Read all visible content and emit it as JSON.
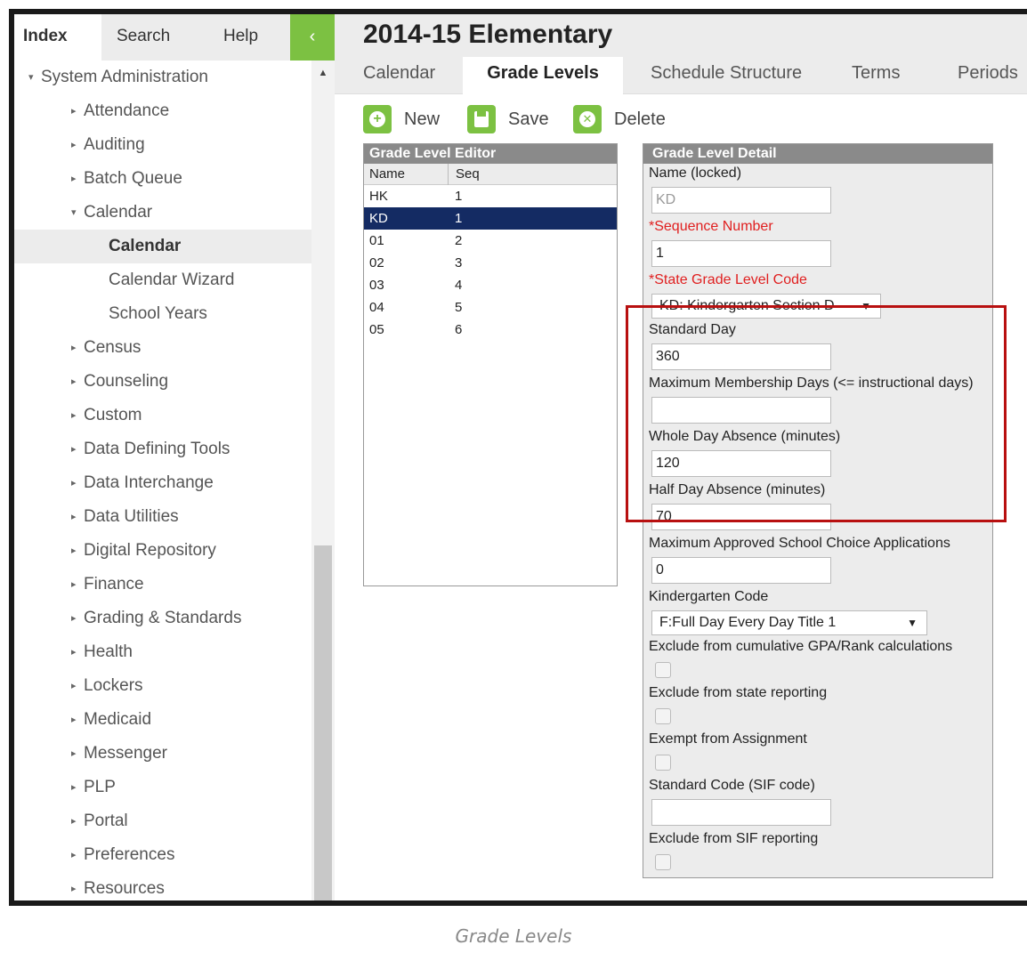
{
  "sidebar": {
    "tabs": {
      "index": "Index",
      "search": "Search",
      "help": "Help"
    },
    "collapse_glyph": "‹",
    "scroll_up_glyph": "▲",
    "collapsed_marker": "▸",
    "expanded_marker": "▾",
    "root": "System Administration",
    "items": [
      "Attendance",
      "Auditing",
      "Batch Queue",
      "Calendar",
      "Census",
      "Counseling",
      "Custom",
      "Data Defining Tools",
      "Data Interchange",
      "Data Utilities",
      "Digital Repository",
      "Finance",
      "Grading & Standards",
      "Health",
      "Lockers",
      "Medicaid",
      "Messenger",
      "PLP",
      "Portal",
      "Preferences",
      "Resources"
    ],
    "calendar_children": [
      "Calendar",
      "Calendar Wizard",
      "School Years"
    ],
    "selected": "Calendar"
  },
  "header": {
    "title": "2014-15 Elementary"
  },
  "tabs": [
    "Calendar",
    "Grade Levels",
    "Schedule Structure",
    "Terms",
    "Periods"
  ],
  "active_tab": "Grade Levels",
  "toolbar": {
    "new_label": "New",
    "save_label": "Save",
    "delete_label": "Delete"
  },
  "editor": {
    "title": "Grade Level Editor",
    "columns": [
      "Name",
      "Seq"
    ],
    "rows": [
      {
        "name": "HK",
        "seq": "1"
      },
      {
        "name": "KD",
        "seq": "1"
      },
      {
        "name": "01",
        "seq": "2"
      },
      {
        "name": "02",
        "seq": "3"
      },
      {
        "name": "03",
        "seq": "4"
      },
      {
        "name": "04",
        "seq": "5"
      },
      {
        "name": "05",
        "seq": "6"
      }
    ],
    "selected_row": "KD"
  },
  "detail": {
    "title": "Grade Level Detail",
    "name_label": "Name (locked)",
    "name_value": "KD",
    "sequence_label": "*Sequence Number",
    "sequence_value": "1",
    "state_code_label": "*State Grade Level Code",
    "state_code_value": "KD: Kindergarten Section D",
    "standard_day_label": "Standard Day",
    "standard_day_value": "360",
    "max_membership_label": "Maximum Membership Days (<= instructional days)",
    "max_membership_value": "",
    "whole_day_label": "Whole Day Absence (minutes)",
    "whole_day_value": "120",
    "half_day_label": "Half Day Absence (minutes)",
    "half_day_value": "70",
    "max_choice_label": "Maximum Approved School Choice Applications",
    "max_choice_value": "0",
    "kindergarten_label": "Kindergarten Code",
    "kindergarten_value": "F:Full Day Every Day Title 1",
    "exclude_gpa_label": "Exclude from cumulative GPA/Rank calculations",
    "exclude_state_label": "Exclude from state reporting",
    "exempt_label": "Exempt from Assignment",
    "sif_code_label": "Standard Code (SIF code)",
    "sif_code_value": "",
    "exclude_sif_label": "Exclude from SIF reporting",
    "select_arrow": "▼"
  },
  "caption": "Grade Levels",
  "colors": {
    "accent_green": "#7cc142",
    "selected_row": "#142b63",
    "highlight": "#b81010",
    "required": "#e02020"
  }
}
